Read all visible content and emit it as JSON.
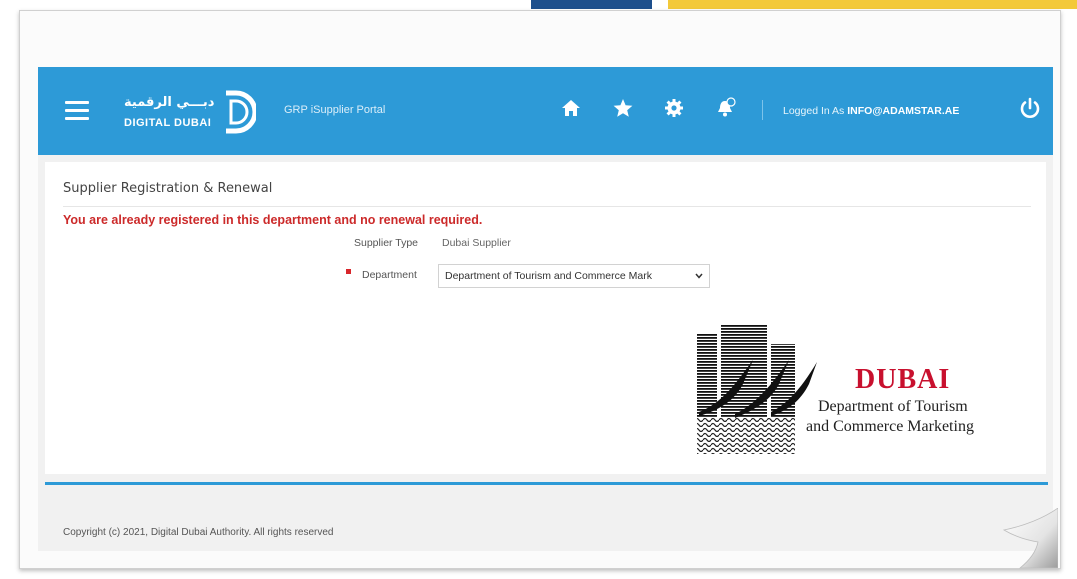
{
  "header": {
    "logo_arabic": "دبـــي الرقمية",
    "logo_text": "DIGITAL DUBAI",
    "portal_title": "GRP iSupplier Portal",
    "logged_prefix": "Logged In As ",
    "logged_user": "INFO@ADAMSTAR.AE",
    "icons": [
      "menu-icon",
      "home-icon",
      "star-icon",
      "gear-icon",
      "bell-icon",
      "power-icon"
    ],
    "color": "#2d9ad7"
  },
  "page": {
    "title": "Supplier Registration & Renewal",
    "error": "You are already registered in this department and no renewal required.",
    "supplier_type_label": "Supplier Type",
    "supplier_type_value": "Dubai Supplier",
    "department_label": "Department",
    "department_value": "Department of Tourism and Commerce Mark",
    "error_color": "#cc2a2a"
  },
  "brand": {
    "name": "DUBAI",
    "line1": "Department of Tourism",
    "line2": "and Commerce Marketing"
  },
  "footer": {
    "copyright": "Copyright (c) 2021, Digital Dubai Authority. All rights reserved"
  }
}
